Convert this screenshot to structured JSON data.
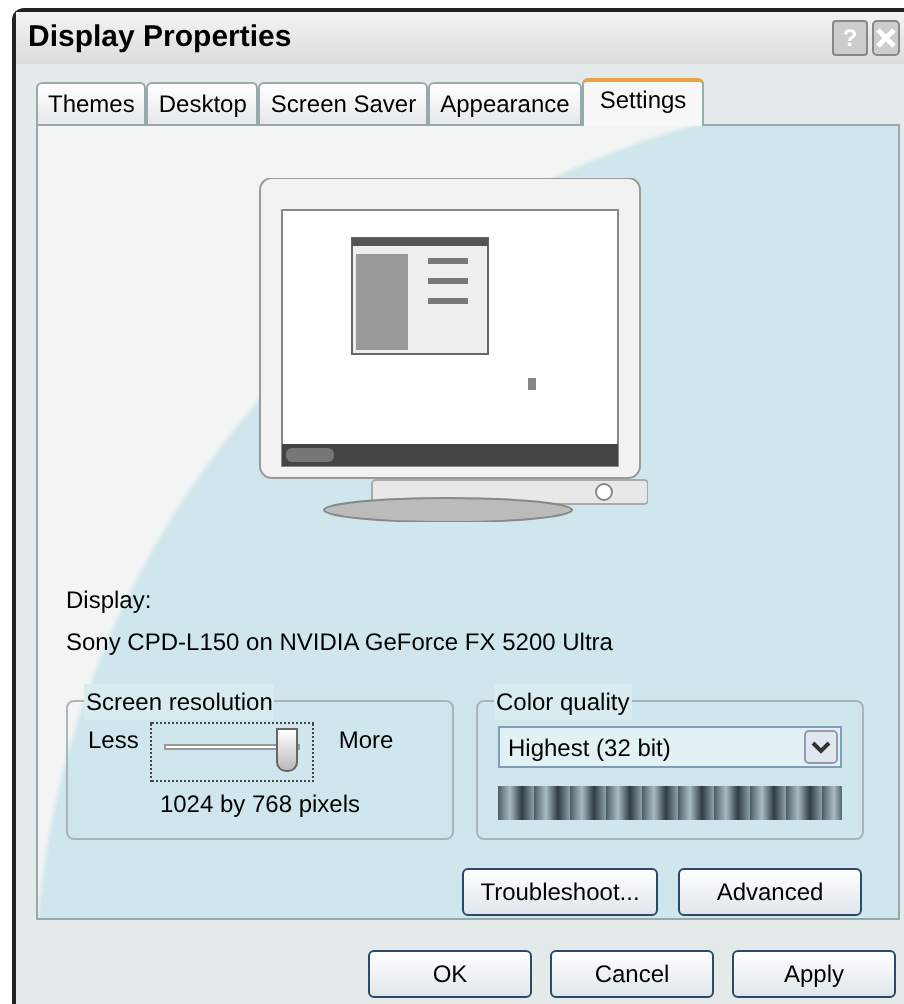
{
  "window": {
    "title": "Display Properties",
    "help_button": "?"
  },
  "tabs": [
    {
      "label": "Themes",
      "selected": false
    },
    {
      "label": "Desktop",
      "selected": false
    },
    {
      "label": "Screen Saver",
      "selected": false
    },
    {
      "label": "Appearance",
      "selected": false
    },
    {
      "label": "Settings",
      "selected": true
    }
  ],
  "display": {
    "label": "Display:",
    "device": "Sony CPD-L150 on NVIDIA GeForce FX 5200 Ultra"
  },
  "screen_resolution": {
    "title": "Screen resolution",
    "min_label": "Less",
    "max_label": "More",
    "level": 0.9,
    "reading": "1024 by 768 pixels"
  },
  "color_quality": {
    "title": "Color quality",
    "value": "Highest (32 bit)"
  },
  "panel_buttons": [
    "Troubleshoot...",
    "Advanced"
  ],
  "dialog_buttons": [
    "OK",
    "Cancel",
    "Apply"
  ]
}
